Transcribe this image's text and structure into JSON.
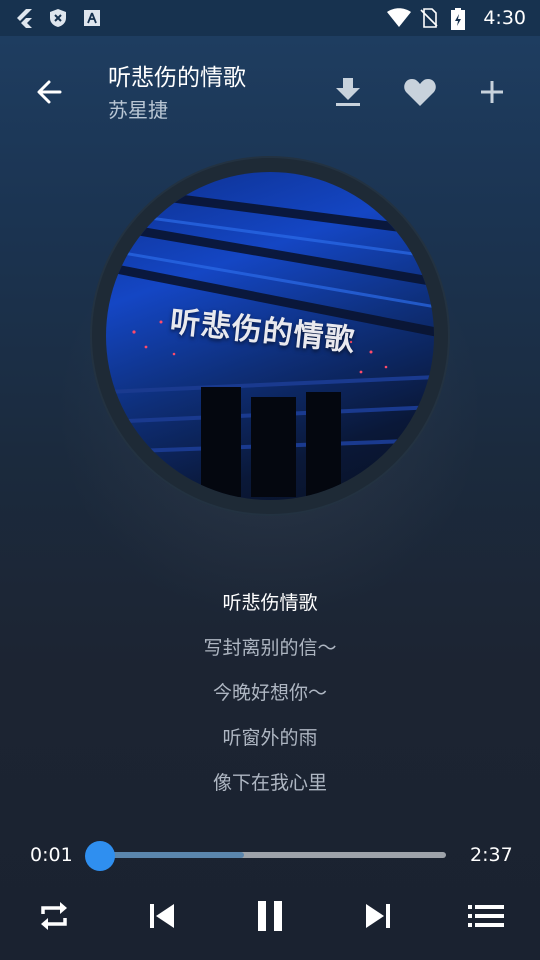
{
  "status_bar": {
    "time": "4:30",
    "left_icons": [
      "flutter-icon",
      "shield-icon",
      "android-studio-icon"
    ],
    "right_icons": [
      "wifi-icon",
      "no-sim-icon",
      "battery-icon"
    ]
  },
  "header": {
    "title": "听悲伤的情歌",
    "artist": "苏星捷",
    "actions": [
      "download-icon",
      "heart-icon",
      "plus-icon"
    ]
  },
  "album": {
    "cover_text": "听悲伤的情歌"
  },
  "lyrics": {
    "lines": [
      "听悲伤情歌",
      "写封离别的信～",
      "今晚好想你～",
      "听窗外的雨",
      "像下在我心里"
    ],
    "active_index": 0
  },
  "player": {
    "current_time": "0:01",
    "total_time": "2:37",
    "played_fraction": 0.006,
    "buffered_fraction": 0.42
  },
  "controls": [
    "repeat-icon",
    "previous-icon",
    "pause-icon",
    "next-icon",
    "playlist-icon"
  ],
  "colors": {
    "accent": "#2f8ff0",
    "background_top": "#1f3f63",
    "background_bottom": "#1a2230"
  }
}
